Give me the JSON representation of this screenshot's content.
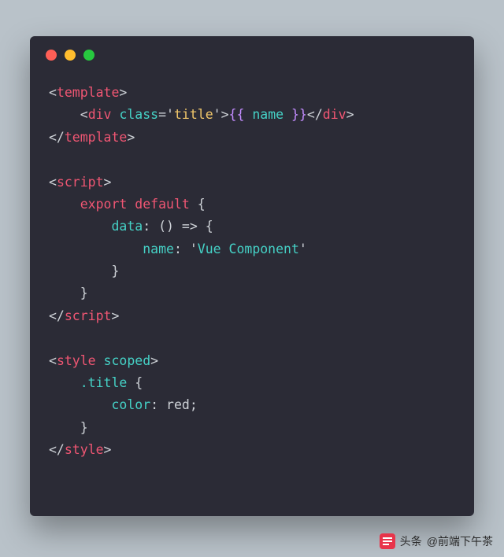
{
  "window": {
    "dots": [
      "red",
      "yellow",
      "green"
    ]
  },
  "code": {
    "l1": {
      "o": "<",
      "tag": "template",
      "c": ">"
    },
    "l2": {
      "ind": "    ",
      "o": "<",
      "tag": "div",
      "sp": " ",
      "attr": "class",
      "eq": "=",
      "q1": "'",
      "val": "title",
      "q2": "'",
      "c": ">",
      "m1": "{{ ",
      "var": "name",
      "m2": " }}",
      "o2": "</",
      "tag2": "div",
      "c2": ">"
    },
    "l3": {
      "o": "</",
      "tag": "template",
      "c": ">"
    },
    "l5": {
      "o": "<",
      "tag": "script",
      "c": ">"
    },
    "l6": {
      "ind": "    ",
      "kw": "export default",
      "rest": " {"
    },
    "l7": {
      "ind": "        ",
      "prop": "data",
      "colon": ": ",
      "arrow": "() => {"
    },
    "l8": {
      "ind": "            ",
      "prop": "name",
      "colon": ": ",
      "q1": "'",
      "val": "Vue Component",
      "q2": "'"
    },
    "l9": {
      "ind": "        ",
      "brace": "}"
    },
    "l10": {
      "ind": "    ",
      "brace": "}"
    },
    "l11": {
      "o": "</",
      "tag": "script",
      "c": ">"
    },
    "l13": {
      "o": "<",
      "tag": "style",
      "sp": " ",
      "attr": "scoped",
      "c": ">"
    },
    "l14": {
      "ind": "    ",
      "sel": ".title",
      "rest": " {"
    },
    "l15": {
      "ind": "        ",
      "prop": "color",
      "colon": ": ",
      "val": "red",
      "semi": ";"
    },
    "l16": {
      "ind": "    ",
      "brace": "}"
    },
    "l17": {
      "o": "</",
      "tag": "style",
      "c": ">"
    }
  },
  "watermark": {
    "prefix": "头条",
    "handle": "@前端下午茶"
  }
}
